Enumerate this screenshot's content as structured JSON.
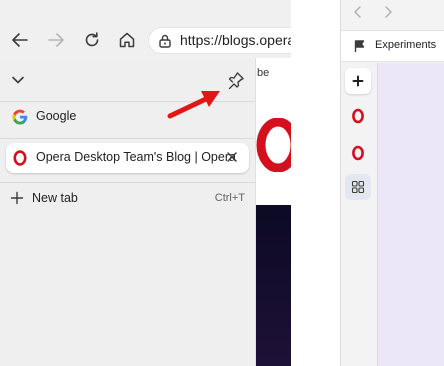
{
  "left_window": {
    "url": "https://blogs.opera.com/",
    "page_partial_text": "be"
  },
  "tab_dropdown": {
    "tabs": [
      {
        "title": "Google",
        "favicon": "google-g-icon"
      },
      {
        "title": "Opera Desktop Team's Blog | Opera",
        "favicon": "opera-o-icon",
        "active": true
      }
    ],
    "new_tab_label": "New tab",
    "new_tab_shortcut": "Ctrl+T"
  },
  "right_window": {
    "tab_title": "Experiments"
  },
  "colors": {
    "opera_red": "#d4101e",
    "annotation_arrow": "#e31616",
    "toolbar_bg": "#f0f0f0",
    "dropdown_bg": "#efefef"
  }
}
